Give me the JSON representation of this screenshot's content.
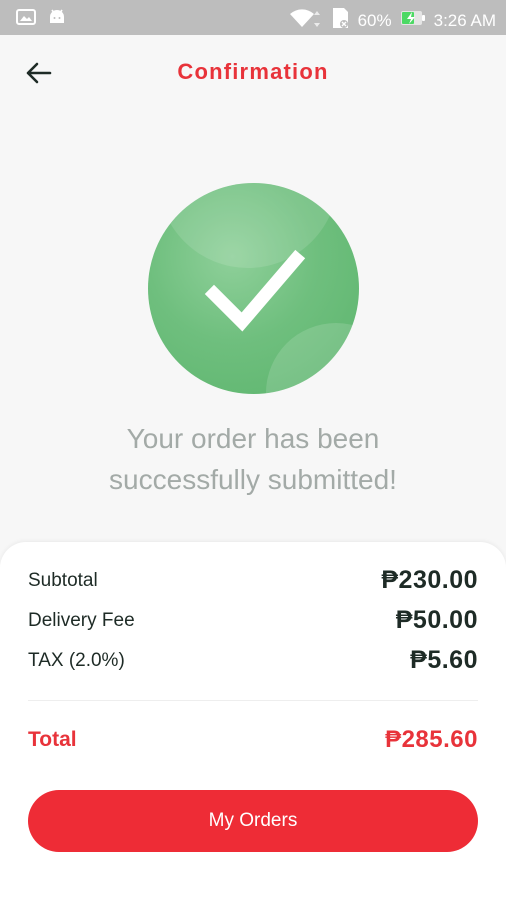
{
  "status_bar": {
    "battery_percent": "60%",
    "time": "3:26 AM"
  },
  "header": {
    "title": "Confirmation"
  },
  "confirmation": {
    "line1": "Your order has been",
    "line2": "successfully submitted!"
  },
  "summary": {
    "subtotal_label": "Subtotal",
    "subtotal_value": "₱230.00",
    "delivery_label": "Delivery Fee",
    "delivery_value": "₱50.00",
    "tax_label": "TAX (2.0%)",
    "tax_value": "₱5.60",
    "total_label": "Total",
    "total_value": "₱285.60"
  },
  "actions": {
    "my_orders_label": "My Orders"
  },
  "colors": {
    "accent_red": "#e8333a",
    "success_green": "#6fbf7e",
    "status_bar": "#bdbdbd"
  },
  "icons": [
    "image-icon",
    "android-icon",
    "wifi-icon",
    "sd-card-icon",
    "battery-charging-icon",
    "back-arrow-icon",
    "checkmark-icon"
  ]
}
